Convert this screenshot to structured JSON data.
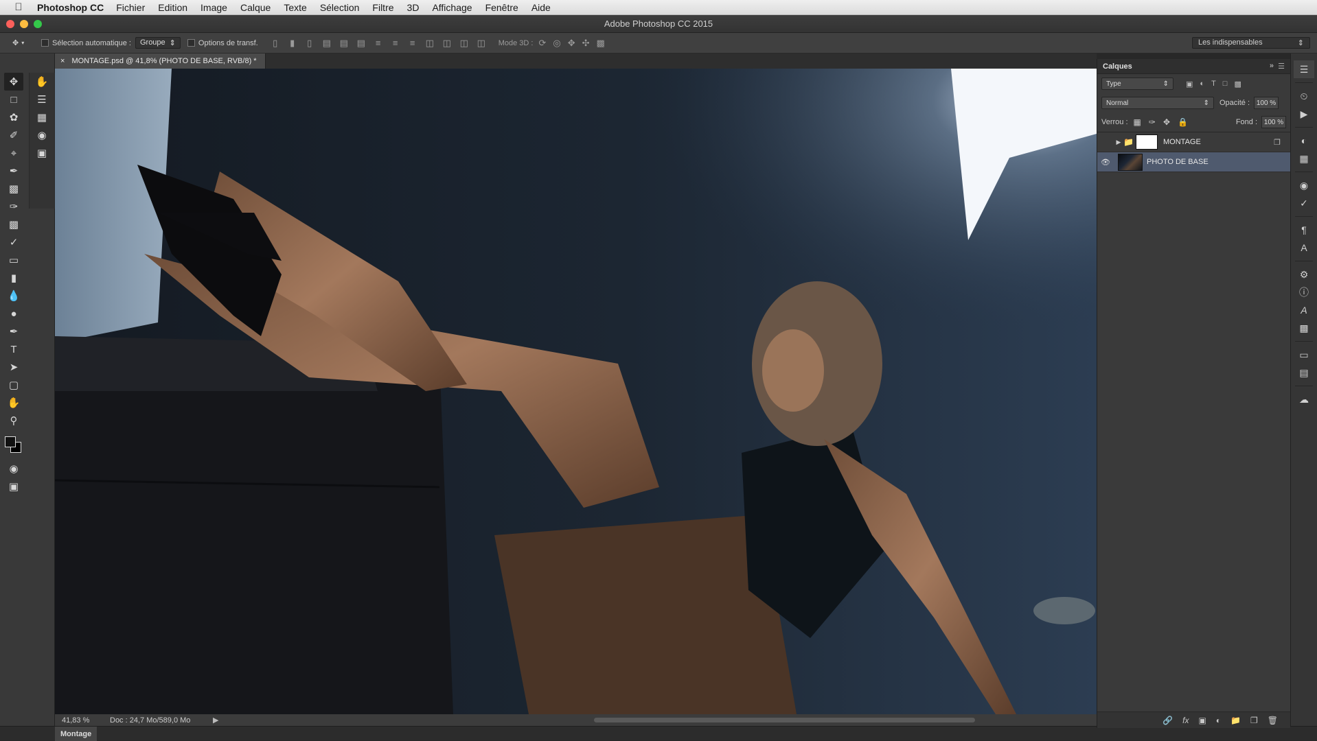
{
  "menubar": {
    "app_name": "Photoshop CC",
    "items": [
      "Fichier",
      "Edition",
      "Image",
      "Calque",
      "Texte",
      "Sélection",
      "Filtre",
      "3D",
      "Affichage",
      "Fenêtre",
      "Aide"
    ]
  },
  "window": {
    "title": "Adobe Photoshop CC 2015"
  },
  "options_bar": {
    "auto_select_label": "Sélection automatique :",
    "auto_select_value": "Groupe",
    "transform_label": "Options de transf.",
    "mode3d_label": "Mode 3D :",
    "workspace": "Les indispensables"
  },
  "document": {
    "tab_title": "MONTAGE.psd @ 41,8% (PHOTO DE BASE, RVB/8) *",
    "close_glyph": "×"
  },
  "status": {
    "zoom": "41,83 %",
    "doc_size": "Doc : 24,7 Mo/589,0 Mo",
    "arrow": "▶"
  },
  "bottom_panel": {
    "tab": "Montage"
  },
  "layers_panel": {
    "title": "Calques",
    "filter_kind": "Type",
    "blend_mode": "Normal",
    "opacity_label": "Opacité :",
    "opacity_value": "100 %",
    "lock_label": "Verrou :",
    "fill_label": "Fond :",
    "fill_value": "100 %",
    "layers": [
      {
        "name": "MONTAGE",
        "type": "group",
        "visible": false,
        "selected": false
      },
      {
        "name": "PHOTO DE BASE",
        "type": "pixel",
        "visible": true,
        "selected": true
      }
    ]
  },
  "colors": {
    "accent_selected": "#4f5a6e",
    "panel_bg": "#3a3a3a",
    "foreground_swatch": "#111111",
    "background_swatch": "#000000"
  }
}
